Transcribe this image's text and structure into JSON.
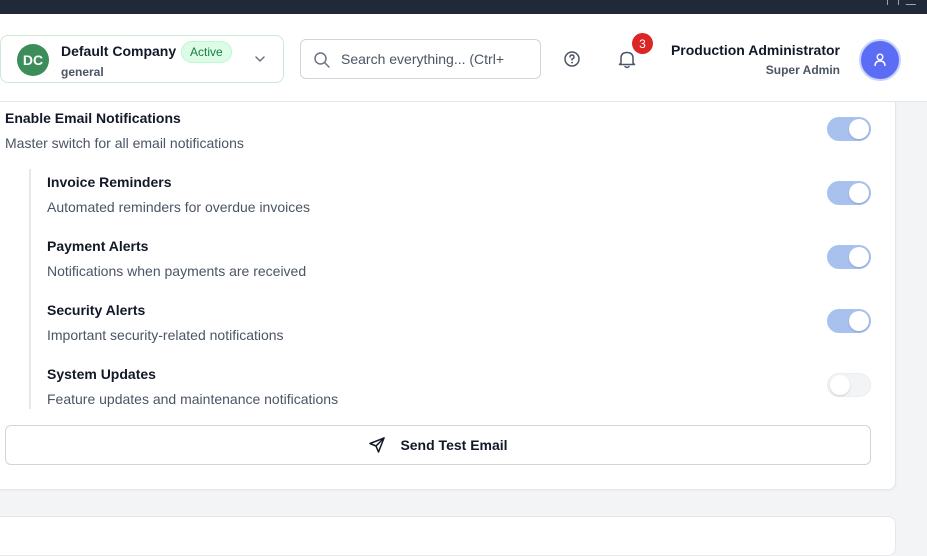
{
  "company": {
    "initials": "DC",
    "name": "Default Company",
    "status": "Active",
    "subtitle": "general"
  },
  "search": {
    "placeholder": "Search everything... (Ctrl+"
  },
  "notifications": {
    "count": "3"
  },
  "user": {
    "name": "Production Administrator",
    "role": "Super Admin"
  },
  "email_settings": {
    "master": {
      "title": "Enable Email Notifications",
      "description": "Master switch for all email notifications",
      "enabled": true
    },
    "items": [
      {
        "title": "Invoice Reminders",
        "description": "Automated reminders for overdue invoices",
        "enabled": true
      },
      {
        "title": "Payment Alerts",
        "description": "Notifications when payments are received",
        "enabled": true
      },
      {
        "title": "Security Alerts",
        "description": "Important security-related notifications",
        "enabled": true
      },
      {
        "title": "System Updates",
        "description": "Feature updates and maintenance notifications",
        "enabled": false
      }
    ],
    "test_button_label": "Send Test Email"
  },
  "colors": {
    "toggle_on": "#a9c1ef",
    "toggle_off": "#f3f4f6",
    "avatar_company": "#3c8d5a",
    "avatar_user": "#5b6df5",
    "badge_red": "#dc2626",
    "active_badge": "#dcfce7"
  },
  "icons": {
    "chevron": "chevron-down-icon",
    "search": "search-icon",
    "help": "help-circle-icon",
    "bell": "bell-icon",
    "user": "user-icon",
    "send": "send-icon"
  }
}
